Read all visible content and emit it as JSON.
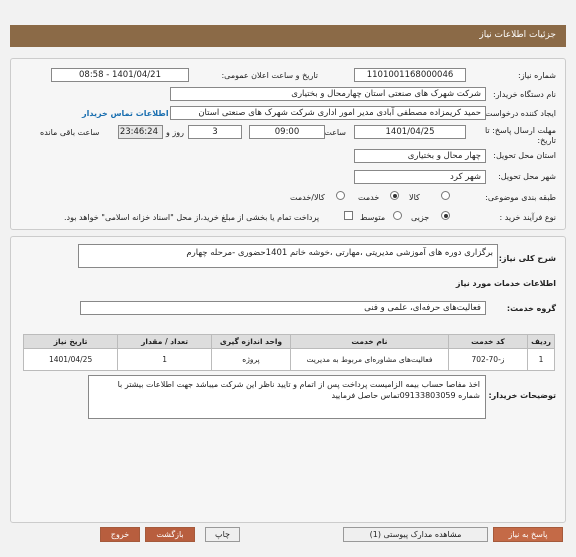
{
  "header": {
    "title": "جزئیات اطلاعات نیاز"
  },
  "need": {
    "need_number_label": "شماره نیاز:",
    "need_number": "1101001168000046",
    "announce_label": "تاریخ و ساعت اعلان عمومی:",
    "announce_value": "1401/04/21 - 08:58",
    "buyer_org_label": "نام دستگاه خریدار:",
    "buyer_org": "شرکت شهرک های صنعتی استان چهارمحال و بختیاری",
    "creator_label": "ایجاد کننده درخواست:",
    "creator": "حمید کریمزاده مصطفی آبادی مدیر امور اداری شرکت شهرک های صنعتی استان",
    "contact_link": "اطلاعات تماس خریدار",
    "deadline_label": "مهلت ارسال پاسخ: تا تاریخ:",
    "deadline_date": "1401/04/25",
    "time_label": "ساعت",
    "deadline_time": "09:00",
    "days_value": "3",
    "days_label": "روز و",
    "remaining_time": "23:46:24",
    "remaining_label": "ساعت باقی مانده",
    "province_label": "استان محل تحویل:",
    "province": "چهار محال و بختیاری",
    "city_label": "شهر محل تحویل:",
    "city": "شهر کرد",
    "category_label": "طبقه بندی موضوعی:",
    "category_options": [
      "کالا",
      "خدمت",
      "کالا/خدمت"
    ],
    "category_selected": 1,
    "process_label": "نوع فرآیند خرید :",
    "process_options": [
      "جزیی",
      "متوسط"
    ],
    "process_selected": 0,
    "treasury_text": "پرداخت تمام یا بخشی از مبلغ خرید،از محل \"اسناد خزانه اسلامی\" خواهد بود."
  },
  "description": {
    "label": "شرح کلی نیاز:",
    "text": "برگزاری دوره های آموزشی مدیریتی ،مهارتی ،خوشه خاتم 1401حضوری -مرحله چهارم"
  },
  "services": {
    "section_title": "اطلاعات خدمات مورد نیاز",
    "group_label": "گروه خدمت:",
    "group_value": "فعالیت‌های حرفه‌ای، علمی و فنی",
    "columns": [
      "ردیف",
      "کد خدمت",
      "نام خدمت",
      "واحد اندازه گیری",
      "تعداد / مقدار",
      "تاریخ نیاز"
    ],
    "rows": [
      [
        "1",
        "ز-70-702",
        "فعالیت‌های مشاوره‌ای مربوط به مدیریت",
        "پروژه",
        "1",
        "1401/04/25"
      ]
    ]
  },
  "buyer_notes": {
    "label": "توضیحات خریدار:",
    "text": "اخذ مفاصا حساب بیمه الزامیست پرداخت پس از اتمام و تایید ناظر این شرکت میباشد جهت اطلاعات بیشتر با شماره 09133803059تماس حاصل فرمایید"
  },
  "buttons": {
    "reply": "پاسخ به نیاز",
    "attachments": "مشاهده مدارک پیوستی (1)",
    "print": "چاپ",
    "back": "بازگشت",
    "exit": "خروج"
  }
}
